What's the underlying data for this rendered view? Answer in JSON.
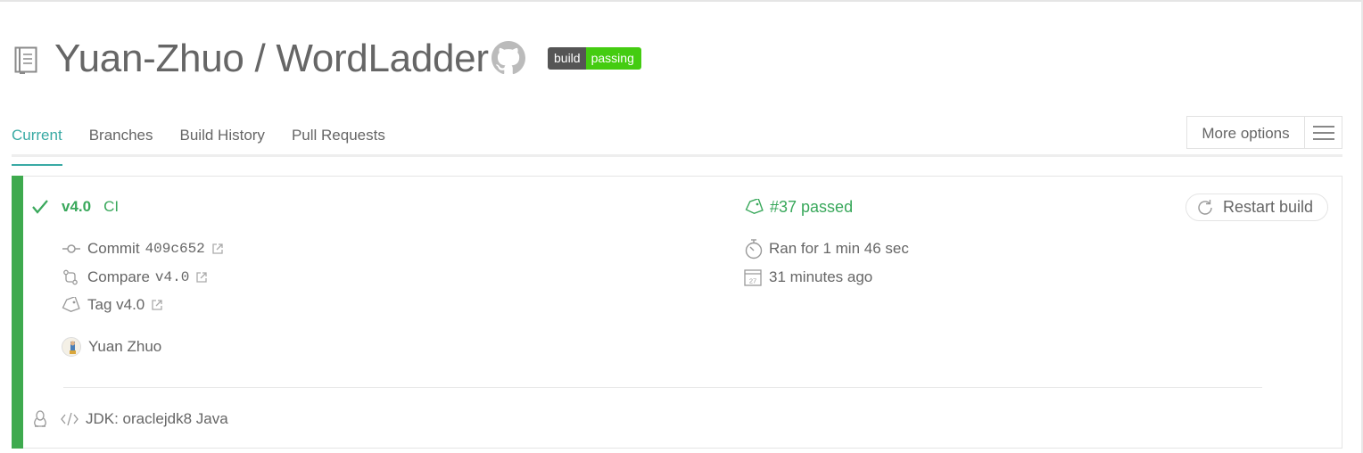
{
  "header": {
    "repo_title": "Yuan-Zhuo / WordLadder",
    "badge_left": "build",
    "badge_right": "passing",
    "badge_color": "#44cc11"
  },
  "tabs": [
    {
      "label": "Current",
      "active": true
    },
    {
      "label": "Branches"
    },
    {
      "label": "Build History"
    },
    {
      "label": "Pull Requests"
    }
  ],
  "more_options_label": "More options",
  "build": {
    "status_color": "#3eaa4e",
    "branch": "v4.0",
    "message": "CI",
    "commit_label": "Commit",
    "commit_hash": "409c652",
    "compare_label": "Compare",
    "compare_ref": "v4.0",
    "tag_label": "Tag v4.0",
    "author": "Yuan Zhuo",
    "build_number": "#37 passed",
    "duration": "Ran for 1 min 46 sec",
    "finished": "31 minutes ago",
    "calendar_day": "27",
    "restart_label": "Restart build",
    "job_env": "JDK: oraclejdk8 Java"
  },
  "icons": [
    "repo-icon",
    "github-icon",
    "check-icon",
    "commit-icon",
    "external-link-icon",
    "compare-icon",
    "tag-icon",
    "avatar",
    "stopwatch-icon",
    "calendar-icon",
    "restart-icon",
    "linux-icon",
    "code-icon",
    "menu-icon"
  ]
}
